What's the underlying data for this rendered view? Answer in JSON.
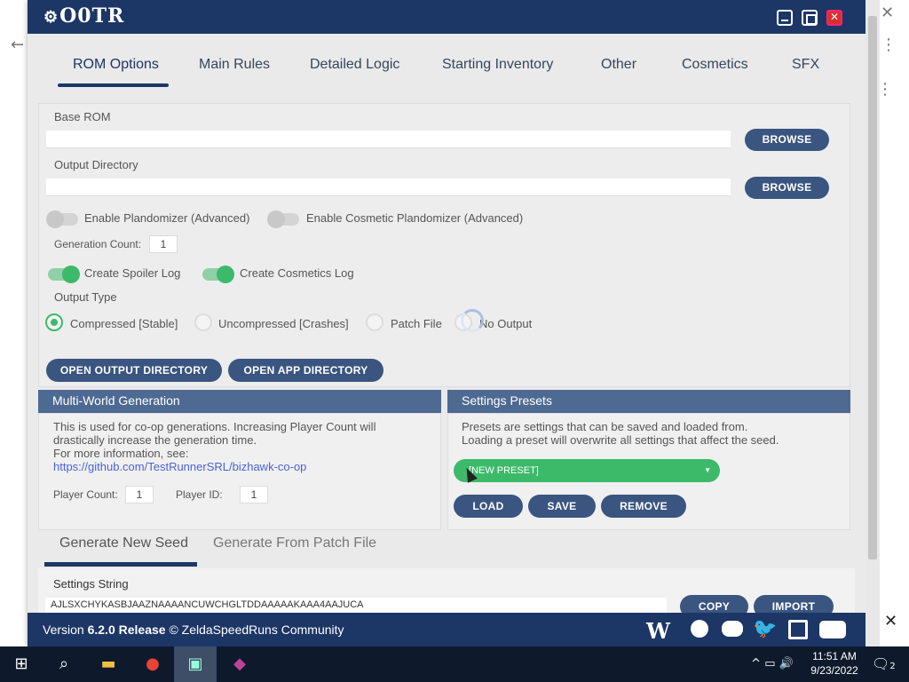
{
  "app": {
    "logo_text": "O0TR"
  },
  "tabs": [
    {
      "label": "ROM Options"
    },
    {
      "label": "Main Rules"
    },
    {
      "label": "Detailed Logic"
    },
    {
      "label": "Starting Inventory"
    },
    {
      "label": "Other"
    },
    {
      "label": "Cosmetics"
    },
    {
      "label": "SFX"
    }
  ],
  "rom": {
    "base_rom_label": "Base ROM",
    "base_rom_value": "",
    "browse_label": "BROWSE",
    "output_dir_label": "Output Directory",
    "output_dir_value": "",
    "enable_plandomizer_label": "Enable Plandomizer (Advanced)",
    "enable_cosmetic_plandomizer_label": "Enable Cosmetic Plandomizer (Advanced)",
    "generation_count_label": "Generation Count:",
    "generation_count_value": "1",
    "create_spoiler_log_label": "Create Spoiler Log",
    "create_cosmetics_log_label": "Create Cosmetics Log",
    "output_type_label": "Output Type",
    "output_types": [
      {
        "label": "Compressed [Stable]",
        "selected": true
      },
      {
        "label": "Uncompressed [Crashes]",
        "selected": false
      },
      {
        "label": "Patch File",
        "selected": false
      },
      {
        "label": "No Output",
        "selected": false
      }
    ],
    "open_output_dir_label": "OPEN OUTPUT DIRECTORY",
    "open_app_dir_label": "OPEN APP DIRECTORY"
  },
  "multiworld": {
    "title": "Multi-World Generation",
    "desc_line1": "This is used for co-op generations. Increasing Player Count will",
    "desc_line2": "drastically increase the generation time.",
    "desc_line3": "For more information, see:",
    "link": "https://github.com/TestRunnerSRL/bizhawk-co-op",
    "player_count_label": "Player Count:",
    "player_count_value": "1",
    "player_id_label": "Player ID:",
    "player_id_value": "1"
  },
  "presets": {
    "title": "Settings Presets",
    "desc_line1": "Presets are settings that can be saved and loaded from.",
    "desc_line2": "Loading a preset will overwrite all settings that affect the seed.",
    "selected": "[NEW PRESET]",
    "load_label": "LOAD",
    "save_label": "SAVE",
    "remove_label": "REMOVE"
  },
  "bottom_tabs": [
    {
      "label": "Generate New Seed"
    },
    {
      "label": "Generate From Patch File"
    }
  ],
  "settings": {
    "label": "Settings String",
    "value": "AJLSXCHYKASBJAAZNAAAANCUWCHGLTDDAAAAAKAAA4AAJUCA",
    "copy_label": "COPY",
    "import_label": "IMPORT"
  },
  "footer": {
    "version_prefix": "Version ",
    "version_number": "6.2.0 Release",
    "credit": " © ZeldaSpeedRuns Community"
  },
  "taskbar": {
    "time": "11:51 AM",
    "date": "9/23/2022",
    "notifications": "2"
  },
  "colors": {
    "title_bar": "#1c3666",
    "accent_green": "#3cba6a",
    "button_blue": "#3a5580",
    "section_header": "#4e6a93"
  }
}
